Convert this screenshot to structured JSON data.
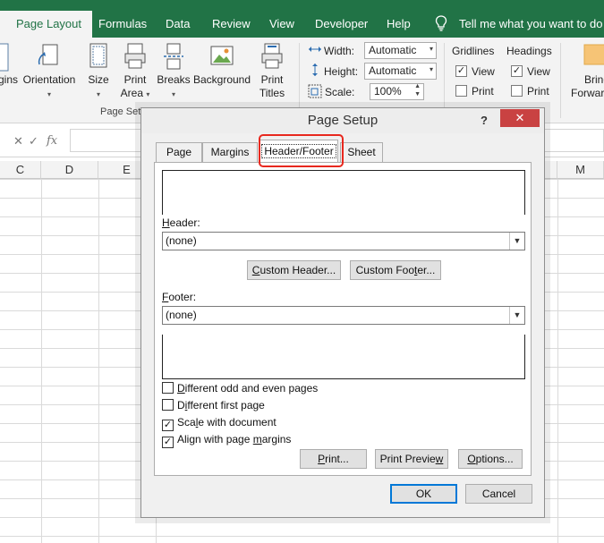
{
  "ribbon": {
    "tabs": [
      {
        "label": "Page Layout",
        "active": true
      },
      {
        "label": "Formulas"
      },
      {
        "label": "Data"
      },
      {
        "label": "Review"
      },
      {
        "label": "View"
      },
      {
        "label": "Developer"
      },
      {
        "label": "Help"
      }
    ],
    "tell_me": "Tell me what you want to do",
    "buttons": {
      "margins": "gins",
      "orientation": "Orientation",
      "size": "Size",
      "print_area": [
        "Print",
        "Area"
      ],
      "breaks": "Breaks",
      "background": "Background",
      "print_titles": [
        "Print",
        "Titles"
      ],
      "bring_forward": [
        "Bring",
        "Forwar"
      ]
    },
    "page_setup_group": "Page Set",
    "scale_to_fit": {
      "width_label": "Width:",
      "width_value": "Automatic",
      "height_label": "Height:",
      "height_value": "Automatic",
      "scale_label": "Scale:",
      "scale_value": "100%"
    },
    "sheet_options": {
      "gridlines": "Gridlines",
      "headings": "Headings",
      "view": "View",
      "print": "Print",
      "gridlines_view": true,
      "gridlines_print": false,
      "headings_view": true,
      "headings_print": false
    }
  },
  "formula_bar": {
    "cancel": "✕",
    "confirm": "✓",
    "fx": "fx"
  },
  "columns": [
    "C",
    "D",
    "E",
    "M"
  ],
  "dialog": {
    "title": "Page Setup",
    "help": "?",
    "close": "✕",
    "tabs": [
      "Page",
      "Margins",
      "Header/Footer",
      "Sheet"
    ],
    "active_tab": "Header/Footer",
    "header_label_pre": "",
    "header_label_u": "H",
    "header_label_post": "eader:",
    "header_value": "(none)",
    "custom_header_u": "C",
    "custom_header_rest": "ustom Header...",
    "custom_footer_pre": "Custom Foo",
    "custom_footer_u": "t",
    "custom_footer_post": "er...",
    "footer_label_u": "F",
    "footer_label_post": "ooter:",
    "footer_value": "(none)",
    "checkboxes": [
      {
        "pre": "",
        "u": "D",
        "post": "ifferent odd and even pages",
        "checked": false
      },
      {
        "pre": "D",
        "u": "i",
        "post": "fferent first page",
        "checked": false
      },
      {
        "pre": "Sca",
        "u": "l",
        "post": "e with document",
        "checked": true
      },
      {
        "pre": "Align with page ",
        "u": "m",
        "post": "argins",
        "checked": true
      }
    ],
    "print_pre": "",
    "print_u": "P",
    "print_post": "rint...",
    "preview_pre": "Print Previe",
    "preview_u": "w",
    "preview_post": "",
    "options_u": "O",
    "options_post": "ptions...",
    "ok": "OK",
    "cancel": "Cancel"
  }
}
